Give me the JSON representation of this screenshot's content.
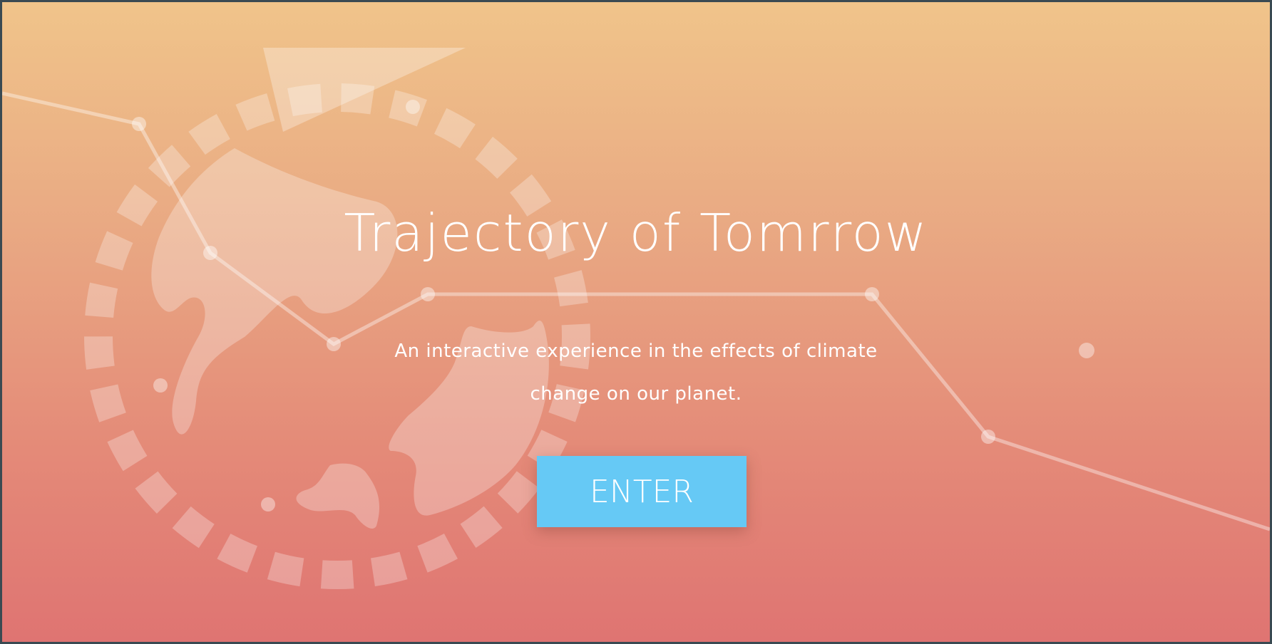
{
  "hero": {
    "title": "Trajectory of Tomrrow",
    "subtitle": "An interactive experience in the effects of climate change on our planet.",
    "enter_label": "ENTER"
  },
  "colors": {
    "background_top": "#f0c48a",
    "background_bottom": "#df7472",
    "button": "#66c9f5",
    "text": "#ffffff"
  },
  "decoration": {
    "icons": [
      "globe-icon",
      "dashed-orbit-ring",
      "trajectory-line",
      "triangle-pointer"
    ]
  }
}
